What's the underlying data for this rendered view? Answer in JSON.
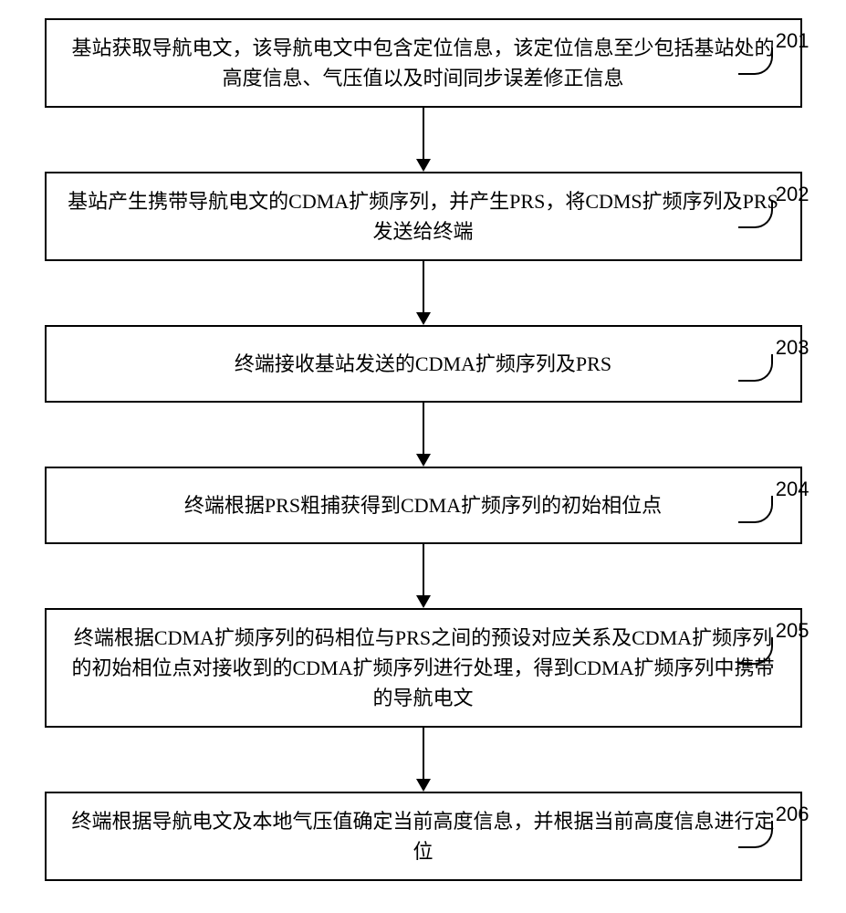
{
  "flowchart": {
    "steps": [
      {
        "number": "201",
        "text": "基站获取导航电文，该导航电文中包含定位信息，该定位信息至少包括基站处的高度信息、气压值以及时间同步误差修正信息"
      },
      {
        "number": "202",
        "text": "基站产生携带导航电文的CDMA扩频序列，并产生PRS，将CDMS扩频序列及PRS发送给终端"
      },
      {
        "number": "203",
        "text": "终端接收基站发送的CDMA扩频序列及PRS"
      },
      {
        "number": "204",
        "text": "终端根据PRS粗捕获得到CDMA扩频序列的初始相位点"
      },
      {
        "number": "205",
        "text": "终端根据CDMA扩频序列的码相位与PRS之间的预设对应关系及CDMA扩频序列的初始相位点对接收到的CDMA扩频序列进行处理，得到CDMA扩频序列中携带的导航电文"
      },
      {
        "number": "206",
        "text": "终端根据导航电文及本地气压值确定当前高度信息，并根据当前高度信息进行定位"
      }
    ]
  }
}
